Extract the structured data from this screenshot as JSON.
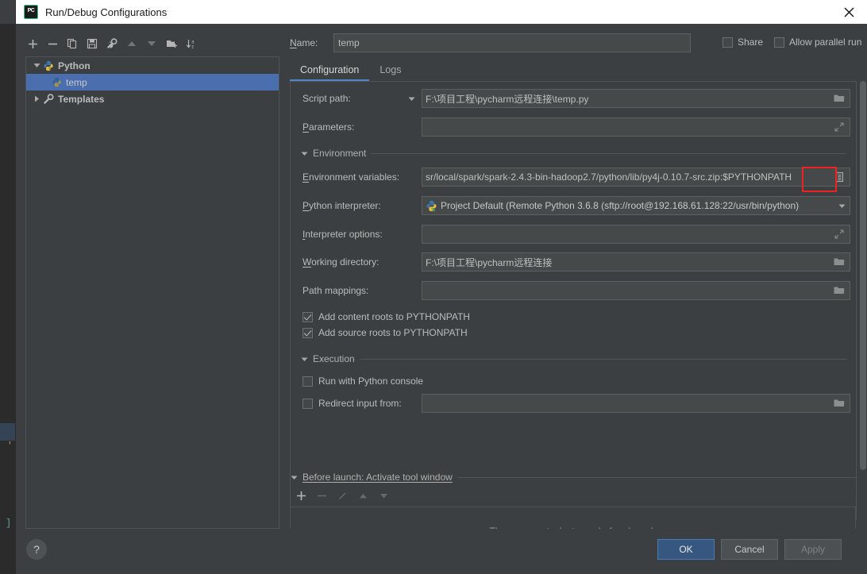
{
  "window": {
    "title": "Run/Debug Configurations",
    "app_icon": "pycharm-logo-icon",
    "close_icon": "close-icon"
  },
  "left_toolbar": {
    "buttons": [
      {
        "name": "add-configuration-button",
        "icon": "plus-icon",
        "disabled": false
      },
      {
        "name": "remove-configuration-button",
        "icon": "minus-icon",
        "disabled": false
      },
      {
        "name": "copy-configuration-button",
        "icon": "copy-icon",
        "disabled": false
      },
      {
        "name": "save-configuration-button",
        "icon": "save-icon",
        "disabled": false
      },
      {
        "name": "edit-templates-button",
        "icon": "wrench-icon",
        "disabled": false
      },
      {
        "name": "move-up-button",
        "icon": "arrow-up-icon",
        "disabled": true
      },
      {
        "name": "move-down-button",
        "icon": "arrow-down-icon",
        "disabled": true
      },
      {
        "name": "move-into-folder-button",
        "icon": "new-folder-icon",
        "disabled": false
      },
      {
        "name": "sort-configurations-button",
        "icon": "sort-az-icon",
        "disabled": false
      }
    ]
  },
  "tree": {
    "items": [
      {
        "label": "Python",
        "icon": "python-icon",
        "twisty": "expanded",
        "level": 0,
        "selected": false
      },
      {
        "label": "temp",
        "icon": "python-file-icon",
        "twisty": "none",
        "level": 1,
        "selected": true
      },
      {
        "label": "Templates",
        "icon": "wrench-icon",
        "twisty": "collapsed",
        "level": 0,
        "selected": false
      }
    ]
  },
  "name_row": {
    "label": "Name:",
    "value": "temp",
    "placeholder": "",
    "share": {
      "label": "Share",
      "checked": false
    },
    "parallel": {
      "label": "Allow parallel run",
      "checked": false
    }
  },
  "tabs": [
    {
      "label": "Configuration",
      "active": true
    },
    {
      "label": "Logs",
      "active": false
    }
  ],
  "form": {
    "script_path": {
      "label": "Script path:",
      "value": "F:\\项目工程\\pycharm远程连接\\temp.py",
      "browse_icon": "folder-icon",
      "mode_arrow_icon": "chevron-down-icon"
    },
    "parameters": {
      "label": "Parameters:",
      "value": "",
      "expand_icon": "expand-diagonal-icon"
    },
    "environment_group": {
      "title": "Environment",
      "twisty": "expanded"
    },
    "environment_variables": {
      "label": "Environment variables:",
      "value": "sr/local/spark/spark-2.4.3-bin-hadoop2.7/python/lib/py4j-0.10.7-src.zip:$PYTHONPATH",
      "edit_icon": "list-edit-icon",
      "highlighted": true,
      "highlight_color": "#ee2222"
    },
    "python_interpreter": {
      "label": "Python interpreter:",
      "value": "Project Default (Remote Python 3.6.8 (sftp://root@192.168.61.128:22/usr/bin/python)",
      "icon": "remote-python-icon",
      "arrow_icon": "chevron-down-icon"
    },
    "interpreter_options": {
      "label": "Interpreter options:",
      "value": "",
      "expand_icon": "expand-diagonal-icon"
    },
    "working_directory": {
      "label": "Working directory:",
      "value": "F:\\项目工程\\pycharm远程连接",
      "browse_icon": "folder-icon"
    },
    "path_mappings": {
      "label": "Path mappings:",
      "value": "",
      "browse_icon": "folder-icon"
    },
    "add_content_roots": {
      "label": "Add content roots to PYTHONPATH",
      "checked": true
    },
    "add_source_roots": {
      "label": "Add source roots to PYTHONPATH",
      "checked": true
    },
    "execution_group": {
      "title": "Execution",
      "twisty": "expanded"
    },
    "run_with_console": {
      "label": "Run with Python console",
      "checked": false
    },
    "redirect_input": {
      "label": "Redirect input from:",
      "checked": false,
      "value": "",
      "browse_icon": "folder-icon"
    }
  },
  "before_launch": {
    "title": "Before launch: Activate tool window",
    "twisty": "expanded",
    "toolbar": [
      {
        "name": "add-task-button",
        "icon": "plus-icon",
        "disabled": false
      },
      {
        "name": "remove-task-button",
        "icon": "minus-icon",
        "disabled": true
      },
      {
        "name": "edit-task-button",
        "icon": "pencil-icon",
        "disabled": true
      },
      {
        "name": "task-move-up-button",
        "icon": "arrow-up-icon",
        "disabled": true
      },
      {
        "name": "task-move-down-button",
        "icon": "arrow-down-icon",
        "disabled": true
      }
    ],
    "empty_message": "There are no tasks to run before launch"
  },
  "bottom_bar": {
    "help_label": "?",
    "ok_label": "OK",
    "cancel_label": "Cancel",
    "apply_label": "Apply"
  },
  "background_editor": {
    "code_fragment_1": "'",
    "code_fragment_2": "]"
  },
  "colors": {
    "accent_blue": "#4b6eaf",
    "tab_underline": "#4a88c7",
    "ok_button": "#365880",
    "highlight_red": "#ee2222",
    "panel_bg": "#3c3f41",
    "field_bg": "#45494a"
  }
}
